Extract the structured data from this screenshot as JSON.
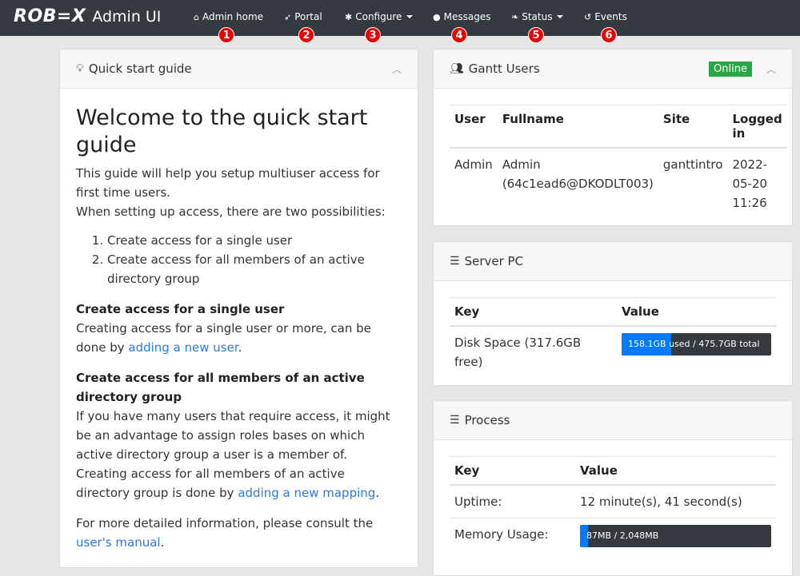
{
  "brand": {
    "logo": "ROB=X",
    "subtitle": "Admin UI"
  },
  "nav": [
    {
      "label": "Admin home",
      "icon": "home-icon",
      "glyph": "⌂",
      "badge": "1",
      "dropdown": false
    },
    {
      "label": "Portal",
      "icon": "rocket-icon",
      "glyph": "➶",
      "badge": "2",
      "dropdown": false
    },
    {
      "label": "Configure",
      "icon": "gear-icon",
      "glyph": "✱",
      "badge": "3",
      "dropdown": true
    },
    {
      "label": "Messages",
      "icon": "comment-icon",
      "glyph": "●",
      "badge": "4",
      "dropdown": false
    },
    {
      "label": "Status",
      "icon": "leaf-icon",
      "glyph": "❧",
      "badge": "5",
      "dropdown": true
    },
    {
      "label": "Events",
      "icon": "history-icon",
      "glyph": "↺",
      "badge": "6",
      "dropdown": false
    }
  ],
  "quickstart": {
    "header": "Quick start guide",
    "title": "Welcome to the quick start guide",
    "intro1": "This guide will help you setup multiuser access for first time users.",
    "intro2": "When setting up access, there are two possibilities:",
    "options": [
      "Create access for a single user",
      "Create access for all members of an active directory group"
    ],
    "single_heading": "Create access for a single user",
    "single_text": "Creating access for a single user or more, can be done by ",
    "single_link": "adding a new user",
    "single_end": ".",
    "group_heading": "Create access for all members of an active directory group",
    "group_text1": "If you have many users that require access, it might be an advantage to assign roles bases on which active directory group a user is a member of.",
    "group_text2": "Creating access for all members of an active directory group is done by ",
    "group_link": "adding a new mapping",
    "group_end": ".",
    "more_text": "For more detailed information, please consult the ",
    "more_link": "user's manual",
    "more_end": "."
  },
  "gantt": {
    "header": "Gantt Users",
    "status": "Online",
    "columns": [
      "User",
      "Fullname",
      "Site",
      "Logged in"
    ],
    "rows": [
      {
        "user": "Admin",
        "fullname": "Admin (64c1ead6@DKODLT003)",
        "site": "ganttintro",
        "logged": "2022-05-20 11:26"
      }
    ]
  },
  "server": {
    "header": "Server PC",
    "columns": [
      "Key",
      "Value"
    ],
    "disk_key": "Disk Space (317.6GB free)",
    "disk_used": "158.1GB",
    "disk_rest": " used / 475.7GB total",
    "disk_fraction": 0.332
  },
  "process": {
    "header": "Process",
    "columns": [
      "Key",
      "Value"
    ],
    "uptime_key": "Uptime:",
    "uptime_value": "12 minute(s), 41 second(s)",
    "mem_key": "Memory Usage:",
    "mem_text": "87MB / 2,048MB",
    "mem_fraction": 0.042
  },
  "colors": {
    "navbar": "#343a40",
    "accent": "#007bff",
    "online": "#28a745",
    "badge": "#ee0000"
  }
}
